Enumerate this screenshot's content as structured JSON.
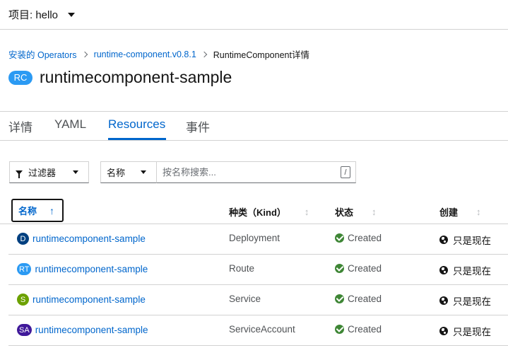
{
  "project": {
    "label": "项目: hello"
  },
  "breadcrumb": {
    "items": [
      "安装的 Operators",
      "runtime-component.v0.8.1"
    ],
    "current": "RuntimeComponent详情"
  },
  "header": {
    "badge": "RC",
    "title": "runtimecomponent-sample"
  },
  "tabs": [
    "详情",
    "YAML",
    "Resources",
    "事件"
  ],
  "active_tab": "Resources",
  "filter": {
    "label": "过滤器",
    "name_select": "名称",
    "search_placeholder": "按名称搜索...",
    "shortcut": "/"
  },
  "table": {
    "columns": [
      "名称",
      "种类（Kind）",
      "状态",
      "创建"
    ],
    "rows": [
      {
        "badge": "D",
        "badge_color": "#004080",
        "name": "runtimecomponent-sample",
        "kind": "Deployment",
        "status": "Created",
        "created": "只是现在"
      },
      {
        "badge": "RT",
        "badge_color": "#2b9af3",
        "name": "runtimecomponent-sample",
        "kind": "Route",
        "status": "Created",
        "created": "只是现在"
      },
      {
        "badge": "S",
        "badge_color": "#6ca100",
        "name": "runtimecomponent-sample",
        "kind": "Service",
        "status": "Created",
        "created": "只是现在"
      },
      {
        "badge": "SA",
        "badge_color": "#40199a",
        "name": "runtimecomponent-sample",
        "kind": "ServiceAccount",
        "status": "Created",
        "created": "只是现在"
      }
    ]
  },
  "colors": {
    "link": "#0066cc",
    "success": "#3e8635",
    "border": "#d2d2d2"
  }
}
